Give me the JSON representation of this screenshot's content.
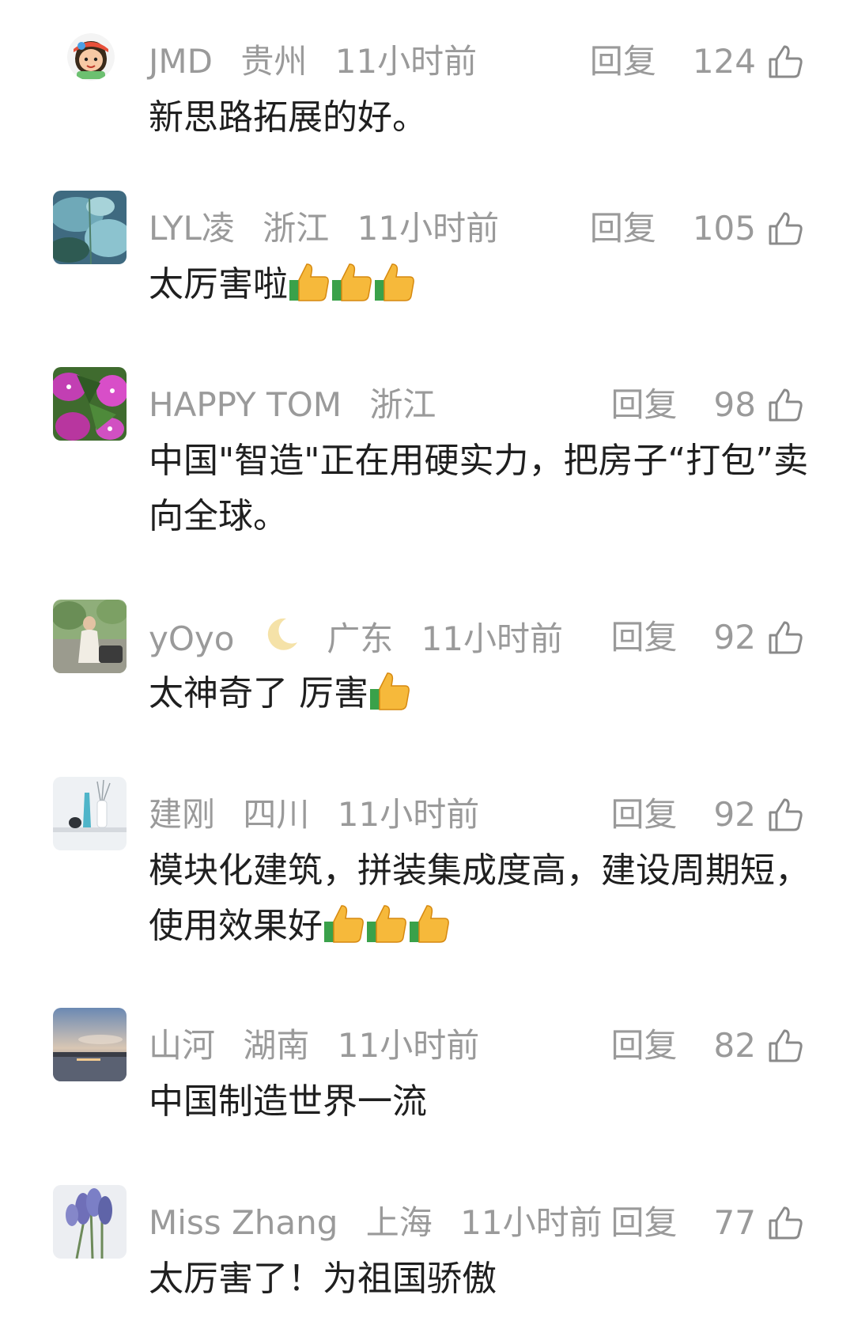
{
  "comments": [
    {
      "user": "JMD",
      "location": "贵州",
      "time": "11小时前",
      "reply_label": "回复",
      "likes": "124",
      "text": "新思路拓展的好。",
      "thumbs": 0,
      "avatar": "cartoon-girl-avatar"
    },
    {
      "user": "LYL凌",
      "location": "浙江",
      "time": "11小时前",
      "reply_label": "回复",
      "likes": "105",
      "text": "太厉害啦",
      "thumbs": 3,
      "avatar": "lotus-leaves-avatar"
    },
    {
      "user": "HAPPY TOM",
      "location": "浙江",
      "time": "",
      "reply_label": "回复",
      "likes": "98",
      "text": "中国\"智造\"正在用硬实力，把房子“打包”卖向全球。",
      "thumbs": 0,
      "avatar": "purple-flowers-avatar"
    },
    {
      "user": "yOyo",
      "location": "广东",
      "time": "11小时前",
      "reply_label": "回复",
      "likes": "92",
      "text": "太神奇了 厉害",
      "thumbs": 1,
      "avatar": "person-photo-avatar",
      "has_moon": true
    },
    {
      "user": "建刚",
      "location": "四川",
      "time": "11小时前",
      "reply_label": "回复",
      "likes": "92",
      "text": "模块化建筑，拼装集成度高，建设周期短，使用效果好",
      "thumbs": 3,
      "avatar": "vases-avatar"
    },
    {
      "user": "山河",
      "location": "湖南",
      "time": "11小时前",
      "reply_label": "回复",
      "likes": "82",
      "text": "中国制造世界一流",
      "thumbs": 0,
      "avatar": "sunset-lake-avatar"
    },
    {
      "user": "Miss Zhang",
      "location": "上海",
      "time": "11小时前",
      "reply_label": "回复",
      "likes": "77",
      "text": "太厉害了！为祖国骄傲",
      "thumbs": 0,
      "avatar": "lavender-avatar"
    }
  ]
}
